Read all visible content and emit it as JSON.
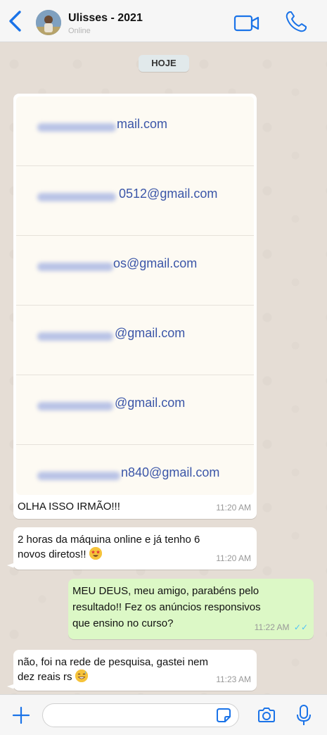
{
  "header": {
    "contact_name": "Ulisses - 2021",
    "status": "Online",
    "back_icon": "chevron-left-icon",
    "video_icon": "video-call-icon",
    "phone_icon": "phone-icon"
  },
  "chat": {
    "date_label": "HOJE",
    "messages": [
      {
        "direction": "incoming",
        "image_emails": [
          "mail.com",
          "0512@gmail.com",
          "os@gmail.com",
          "@gmail.com",
          "@gmail.com",
          "n840@gmail.com"
        ],
        "text": "OLHA ISSO IRMÃO!!!",
        "time": "11:20 AM"
      },
      {
        "direction": "incoming",
        "text_line1": "2 horas da máquina online e já tenho 6",
        "text_line2": "novos diretos!!",
        "emoji": "star-struck",
        "time": "11:20 AM"
      },
      {
        "direction": "outgoing",
        "text_line1": "MEU DEUS, meu amigo, parabéns pelo",
        "text_line2": "resultado!! Fez os anúncios responsivos",
        "text_line3": "que ensino no curso?",
        "time": "11:22 AM",
        "read": true
      },
      {
        "direction": "incoming",
        "text_line1": "não, foi na rede de pesquisa, gastei nem",
        "text_line2": "dez reais rs",
        "emoji": "grinning-sweat",
        "time": "11:23 AM"
      }
    ]
  },
  "footer": {
    "input_value": "",
    "icons": [
      "plus-icon",
      "sticker-icon",
      "camera-icon",
      "microphone-icon"
    ]
  },
  "colors": {
    "accent": "#1a73e8",
    "chat_bg": "#e5ddd5",
    "outgoing_bubble": "#dcf8c6",
    "incoming_bubble": "#ffffff"
  }
}
